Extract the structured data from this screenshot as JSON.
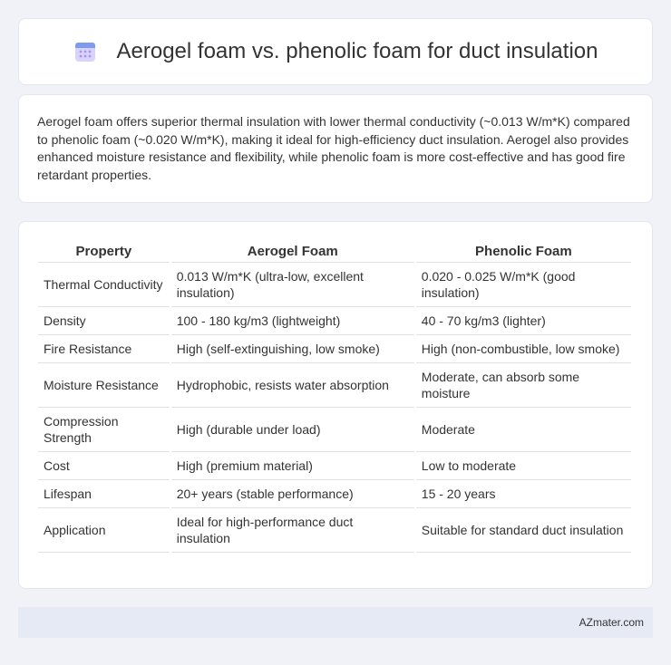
{
  "header": {
    "icon": "calendar-grid-icon",
    "title": "Aerogel foam vs. phenolic foam for duct insulation"
  },
  "summary": {
    "text": "Aerogel foam offers superior thermal insulation with lower thermal conductivity (~0.013 W/m*K) compared to phenolic foam (~0.020 W/m*K), making it ideal for high-efficiency duct insulation. Aerogel also provides enhanced moisture resistance and flexibility, while phenolic foam is more cost-effective and has good fire retardant properties."
  },
  "table": {
    "headers": [
      "Property",
      "Aerogel Foam",
      "Phenolic Foam"
    ],
    "rows": [
      [
        "Thermal Conductivity",
        "0.013 W/m*K (ultra-low, excellent insulation)",
        "0.020 - 0.025 W/m*K (good insulation)"
      ],
      [
        "Density",
        "100 - 180 kg/m3 (lightweight)",
        "40 - 70 kg/m3 (lighter)"
      ],
      [
        "Fire Resistance",
        "High (self-extinguishing, low smoke)",
        "High (non-combustible, low smoke)"
      ],
      [
        "Moisture Resistance",
        "Hydrophobic, resists water absorption",
        "Moderate, can absorb some moisture"
      ],
      [
        "Compression Strength",
        "High (durable under load)",
        "Moderate"
      ],
      [
        "Cost",
        "High (premium material)",
        "Low to moderate"
      ],
      [
        "Lifespan",
        "20+ years (stable performance)",
        "15 - 20 years"
      ],
      [
        "Application",
        "Ideal for high-performance duct insulation",
        "Suitable for standard duct insulation"
      ]
    ]
  },
  "footer": {
    "site": "AZmater.com"
  },
  "colors": {
    "background": "#f0f2f8",
    "card": "#ffffff",
    "footer": "#e6eaf5",
    "icon_accent": "#8b7cf6"
  }
}
